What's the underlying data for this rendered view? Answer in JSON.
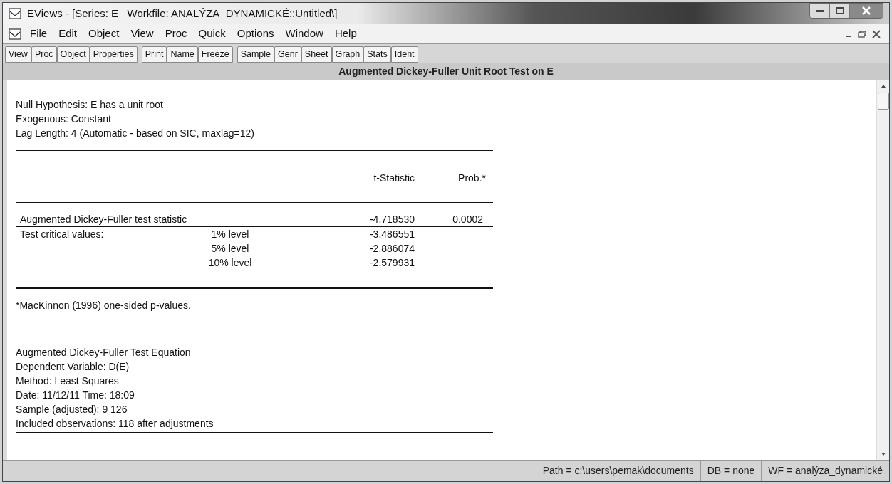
{
  "window": {
    "title": "EViews - [Series: E   Workfile: ANALÝZA_DYNAMICKÉ::Untitled\\]"
  },
  "menu": [
    "File",
    "Edit",
    "Object",
    "View",
    "Proc",
    "Quick",
    "Options",
    "Window",
    "Help"
  ],
  "toolbar": [
    [
      "View",
      "Proc",
      "Object",
      "Properties"
    ],
    [
      "Print",
      "Name",
      "Freeze"
    ],
    [
      "Sample",
      "Genr",
      "Sheet",
      "Graph",
      "Stats",
      "Ident"
    ]
  ],
  "output": {
    "title": "Augmented Dickey-Fuller Unit Root Test on E",
    "header_lines": [
      "Null Hypothesis: E has a unit root",
      "Exogenous: Constant",
      "Lag Length: 4 (Automatic - based on SIC, maxlag=12)"
    ],
    "table": {
      "columns": [
        "t-Statistic",
        "Prob.*"
      ],
      "rows": [
        {
          "kind": "statistic",
          "label": "Augmented Dickey-Fuller test statistic",
          "t_statistic": "-4.718530",
          "prob": "0.0002"
        },
        {
          "kind": "critical",
          "label": "Test critical values:",
          "level": "1% level",
          "t_statistic": "-3.486551"
        },
        {
          "kind": "critical",
          "level": "5% level",
          "t_statistic": "-2.886074"
        },
        {
          "kind": "critical",
          "level": "10% level",
          "t_statistic": "-2.579931"
        }
      ]
    },
    "footnote": "*MacKinnon (1996) one-sided p-values.",
    "equation_lines": [
      "Augmented Dickey-Fuller Test Equation",
      "Dependent Variable: D(E)",
      "Method: Least Squares",
      "Date: 11/12/11   Time: 18:09",
      "Sample (adjusted): 9 126",
      "Included observations: 118 after adjustments"
    ]
  },
  "status_bar": [
    "Path = c:\\users\\pemak\\documents",
    "DB = none",
    "WF = analýza_dynamické"
  ]
}
